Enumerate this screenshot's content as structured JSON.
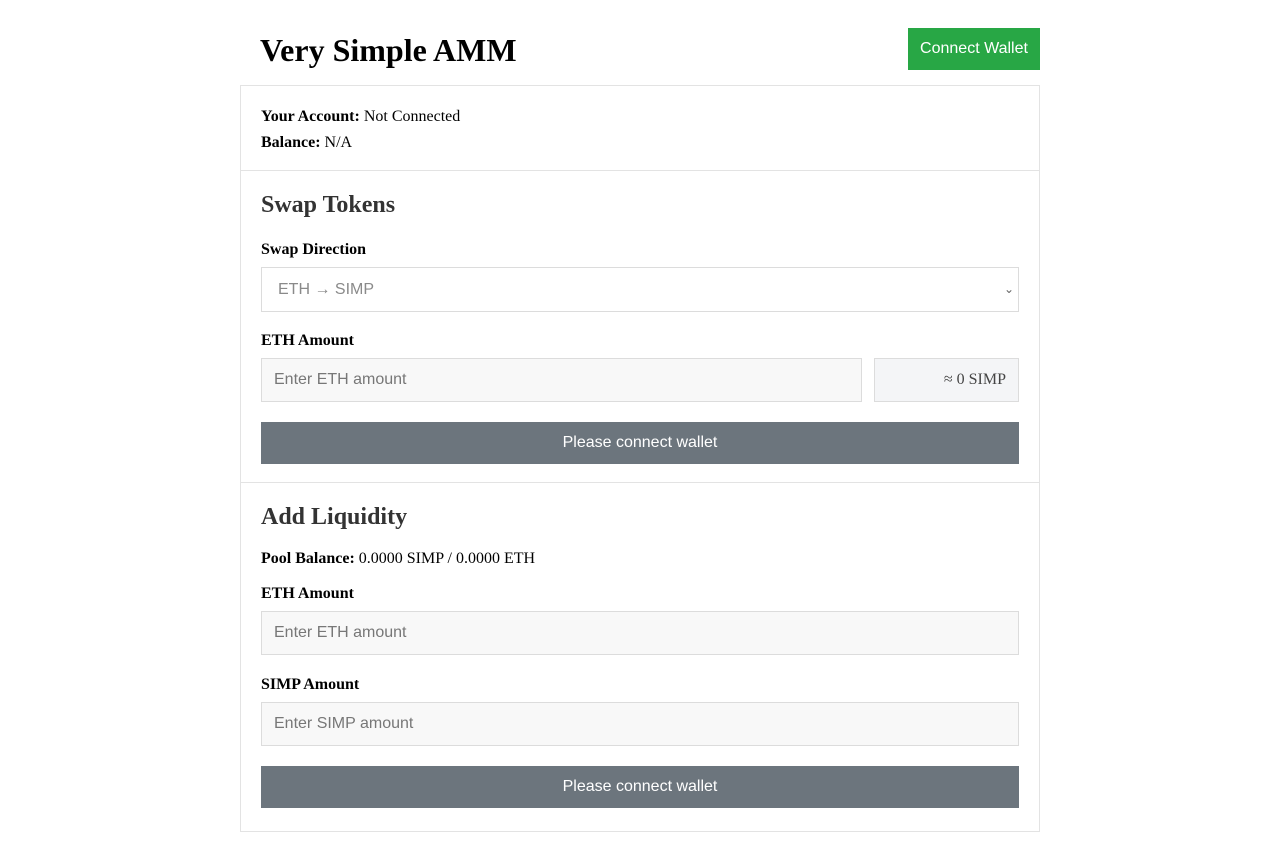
{
  "header": {
    "title": "Very Simple AMM",
    "connect_label": "Connect Wallet"
  },
  "account": {
    "account_label": "Your Account:",
    "account_value": "Not Connected",
    "balance_label": "Balance:",
    "balance_value": "N/A"
  },
  "swap": {
    "title": "Swap Tokens",
    "direction_label": "Swap Direction",
    "direction_value": "ETH → SIMP",
    "amount_label": "ETH Amount",
    "amount_placeholder": "Enter ETH amount",
    "estimate": "≈ 0 SIMP",
    "button_label": "Please connect wallet"
  },
  "liquidity": {
    "title": "Add Liquidity",
    "pool_label": "Pool Balance:",
    "pool_value": "0.0000 SIMP / 0.0000 ETH",
    "eth_label": "ETH Amount",
    "eth_placeholder": "Enter ETH amount",
    "simp_label": "SIMP Amount",
    "simp_placeholder": "Enter SIMP amount",
    "button_label": "Please connect wallet"
  },
  "icons": {
    "select_chevron": "chevron-down-icon"
  },
  "colors": {
    "connect_button": "#28a745",
    "action_button": "#6c757d"
  }
}
